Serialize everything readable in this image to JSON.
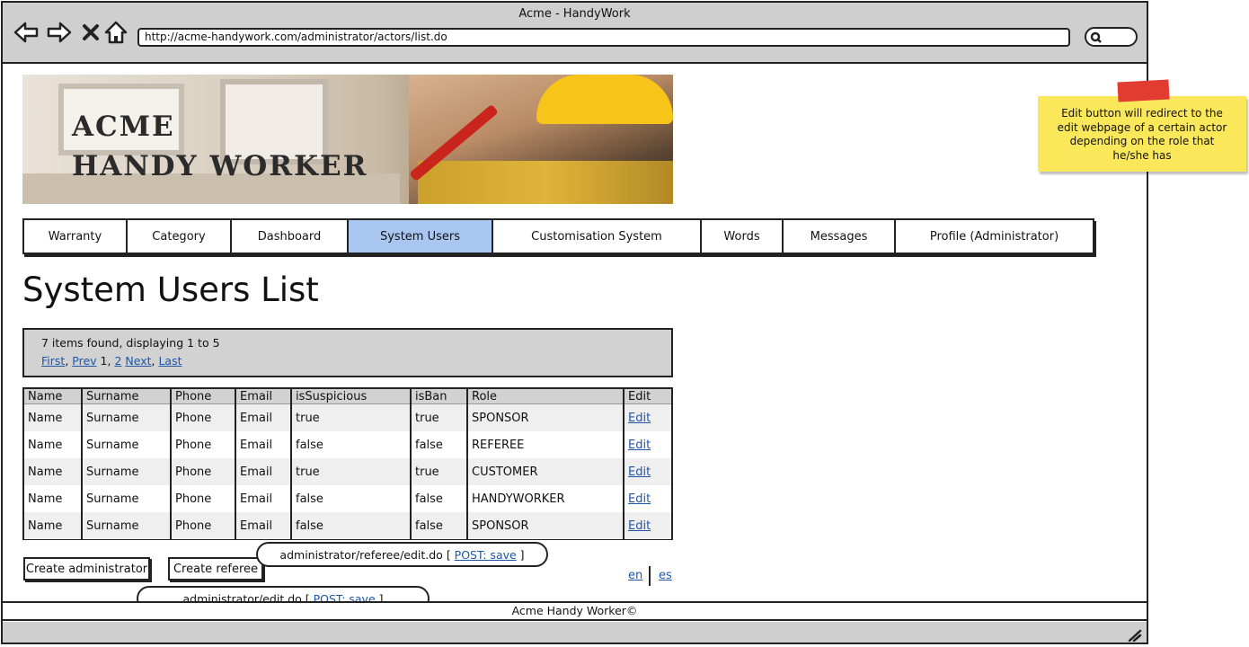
{
  "browser": {
    "title": "Acme - HandyWork",
    "url": "http://acme-handywork.com/administrator/actors/list.do"
  },
  "banner": {
    "line1": "ACME",
    "line2": "HANDY WORKER"
  },
  "note": {
    "text": "Edit button will redirect to the edit webpage of a certain actor depending on the role that he/she has"
  },
  "nav": {
    "tabs": [
      {
        "label": "Warranty"
      },
      {
        "label": "Category"
      },
      {
        "label": "Dashboard"
      },
      {
        "label": "System Users"
      },
      {
        "label": "Customisation System"
      },
      {
        "label": "Words"
      },
      {
        "label": "Messages"
      },
      {
        "label": "Profile (Administrator)"
      }
    ],
    "active": "System Users"
  },
  "page": {
    "title": "System Users List"
  },
  "pager": {
    "summary": "7 items found, displaying 1 to 5",
    "first": "First",
    "prev": "Prev",
    "current": "1",
    "page2": "2",
    "next": "Next",
    "last": "Last"
  },
  "table": {
    "headers": [
      "Name",
      "Surname",
      "Phone",
      "Email",
      "isSuspicious",
      "isBan",
      "Role",
      "Edit"
    ],
    "rows": [
      {
        "name": "Name",
        "surname": "Surname",
        "phone": "Phone",
        "email": "Email",
        "suspicious": "true",
        "ban": "true",
        "role": "SPONSOR",
        "edit": "Edit"
      },
      {
        "name": "Name",
        "surname": "Surname",
        "phone": "Phone",
        "email": "Email",
        "suspicious": "false",
        "ban": "false",
        "role": "REFEREE",
        "edit": "Edit"
      },
      {
        "name": "Name",
        "surname": "Surname",
        "phone": "Phone",
        "email": "Email",
        "suspicious": "true",
        "ban": "true",
        "role": "CUSTOMER",
        "edit": "Edit"
      },
      {
        "name": "Name",
        "surname": "Surname",
        "phone": "Phone",
        "email": "Email",
        "suspicious": "false",
        "ban": "false",
        "role": "HANDYWORKER",
        "edit": "Edit"
      },
      {
        "name": "Name",
        "surname": "Surname",
        "phone": "Phone",
        "email": "Email",
        "suspicious": "false",
        "ban": "false",
        "role": "SPONSOR",
        "edit": "Edit"
      }
    ]
  },
  "buttons": {
    "create_admin": "Create administrator",
    "create_referee": "Create referee"
  },
  "callouts": {
    "referee_path": "administrator/referee/edit.do",
    "referee_action": "POST: save",
    "admin_path": "administrator/edit.do",
    "admin_action": "POST: save"
  },
  "lang": {
    "en": "en",
    "es": "es"
  },
  "footer": {
    "text": "Acme Handy Worker©"
  },
  "colors": {
    "active_tab": "#a9c6f1",
    "chrome": "#cfcfcf",
    "link": "#1f56a8",
    "note": "#fbe85a",
    "note_tape": "#e23b32"
  }
}
